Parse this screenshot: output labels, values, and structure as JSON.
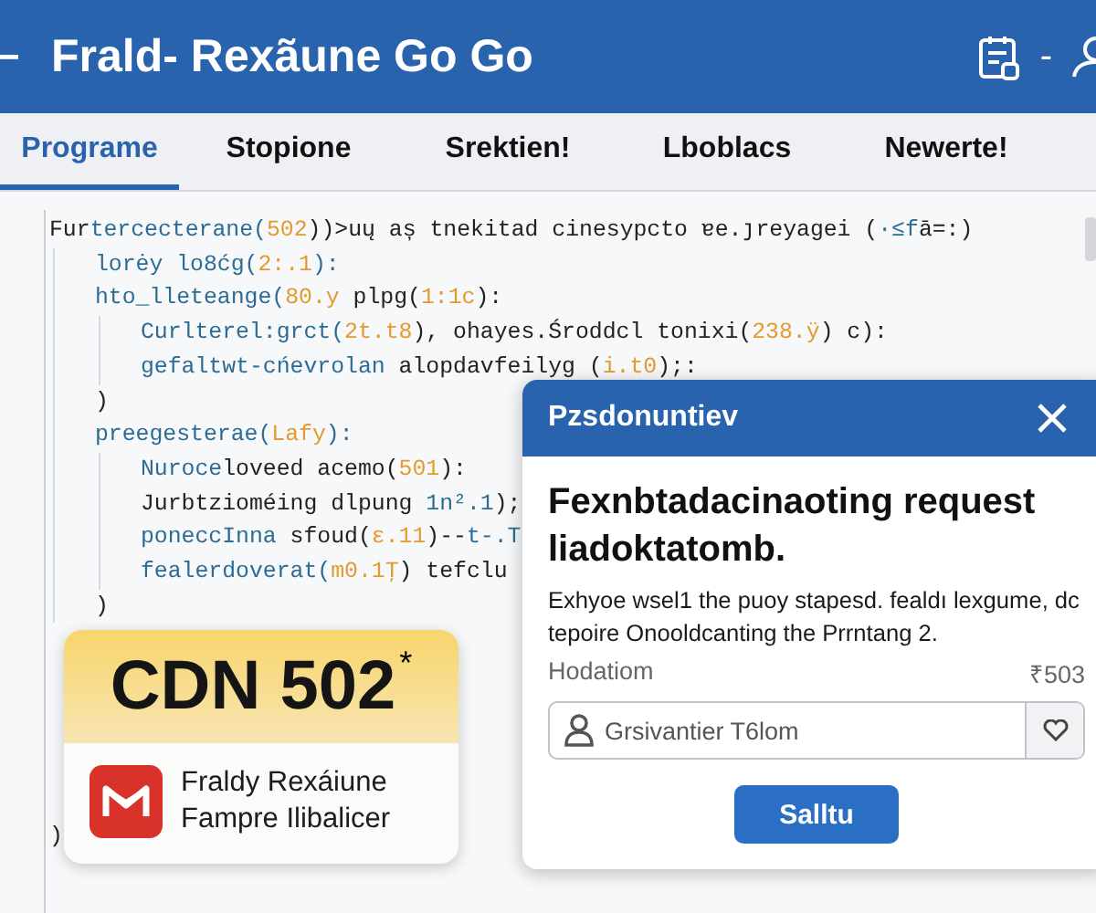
{
  "app_bar": {
    "title": "Frald- Rexãune Go Go",
    "separator": "-"
  },
  "tabs": [
    {
      "label": "Programe",
      "selected": true
    },
    {
      "label": "Stopione",
      "selected": false
    },
    {
      "label": "Srektien!",
      "selected": false
    },
    {
      "label": "Lboblacs",
      "selected": false
    },
    {
      "label": "Newerte!",
      "selected": false
    }
  ],
  "code": [
    {
      "segments": [
        {
          "kind": "plain",
          "text": "Fur"
        },
        {
          "kind": "fn",
          "text": "tercecterane("
        },
        {
          "kind": "number",
          "text": "502"
        },
        {
          "kind": "plain",
          "text": "))>uų aș tnekitad cinesypcto ɐe.ȷreyagei ("
        },
        {
          "kind": "fn",
          "text": "·≤f"
        },
        {
          "kind": "plain",
          "text": "ā=:)"
        }
      ],
      "children": [
        {
          "segments": [
            {
              "kind": "fn",
              "text": "lorėy lo8ćg("
            },
            {
              "kind": "number",
              "text": "2:.1"
            },
            {
              "kind": "fn",
              "text": "):"
            }
          ]
        },
        {
          "segments": [
            {
              "kind": "fn",
              "text": "hto_lleteange("
            },
            {
              "kind": "number",
              "text": "80.y"
            },
            {
              "kind": "plain",
              "text": " plpg("
            },
            {
              "kind": "number",
              "text": "1:1ϲ"
            },
            {
              "kind": "plain",
              "text": "):"
            }
          ],
          "children": [
            {
              "segments": [
                {
                  "kind": "fn",
                  "text": "Curlterel:grct("
                },
                {
                  "kind": "number",
                  "text": "2t.t8"
                },
                {
                  "kind": "plain",
                  "text": "), ohayes.Środdcl tonixi("
                },
                {
                  "kind": "number",
                  "text": "238.ÿ"
                },
                {
                  "kind": "plain",
                  "text": ") c):"
                }
              ]
            },
            {
              "segments": [
                {
                  "kind": "fn",
                  "text": "gefaltwt-cńevrolan"
                },
                {
                  "kind": "plain",
                  "text": " alopdavfeilyg ("
                },
                {
                  "kind": "number",
                  "text": "i.t0"
                },
                {
                  "kind": "plain",
                  "text": ");:"
                }
              ]
            }
          ]
        },
        {
          "segments": [
            {
              "kind": "plain",
              "text": ")"
            }
          ]
        },
        {
          "segments": [
            {
              "kind": "fn",
              "text": "preegesterae("
            },
            {
              "kind": "number",
              "text": "Lafy"
            },
            {
              "kind": "fn",
              "text": "):"
            }
          ],
          "children": [
            {
              "segments": [
                {
                  "kind": "fn",
                  "text": "Nuroce"
                },
                {
                  "kind": "plain",
                  "text": "loveed acemo("
                },
                {
                  "kind": "number",
                  "text": "501"
                },
                {
                  "kind": "plain",
                  "text": "):"
                }
              ]
            },
            {
              "segments": [
                {
                  "kind": "plain",
                  "text": "Jurbtzioméing dlpung "
                },
                {
                  "kind": "fn",
                  "text": "1n².1"
                },
                {
                  "kind": "plain",
                  "text": ");"
                }
              ]
            },
            {
              "segments": [
                {
                  "kind": "fn",
                  "text": "poneccInna"
                },
                {
                  "kind": "plain",
                  "text": " sfoud("
                },
                {
                  "kind": "number",
                  "text": "ε.11"
                },
                {
                  "kind": "plain",
                  "text": ")--"
                },
                {
                  "kind": "fn",
                  "text": "t-.T"
                }
              ]
            },
            {
              "segments": [
                {
                  "kind": "fn",
                  "text": "fealerdoverat("
                },
                {
                  "kind": "number",
                  "text": "m0.1Ţ"
                },
                {
                  "kind": "plain",
                  "text": ") tefclu"
                }
              ]
            }
          ]
        },
        {
          "segments": [
            {
              "kind": "plain",
              "text": ")"
            }
          ]
        }
      ]
    },
    {
      "segments": [
        {
          "kind": "plain",
          "text": ")"
        }
      ]
    }
  ],
  "badge_card": {
    "code": "CDN 502",
    "mark": "*",
    "lines": [
      "Fraldy Rexáiune",
      "Fampre Ilibalicer"
    ]
  },
  "dialog": {
    "title": "Pzsdonuntiev",
    "heading": "Fexnbtadacinaoting request liadoktatomb.",
    "body": "Exhyoe wsel1 the puoy stapesd. fealdı lexgume, dc tepoire Onooldcanting the Prrntang 2.",
    "field_label": "Hodatiom",
    "field_count": "₹503",
    "field_value": "Grsivantier T6lom",
    "button": "Salltu"
  }
}
